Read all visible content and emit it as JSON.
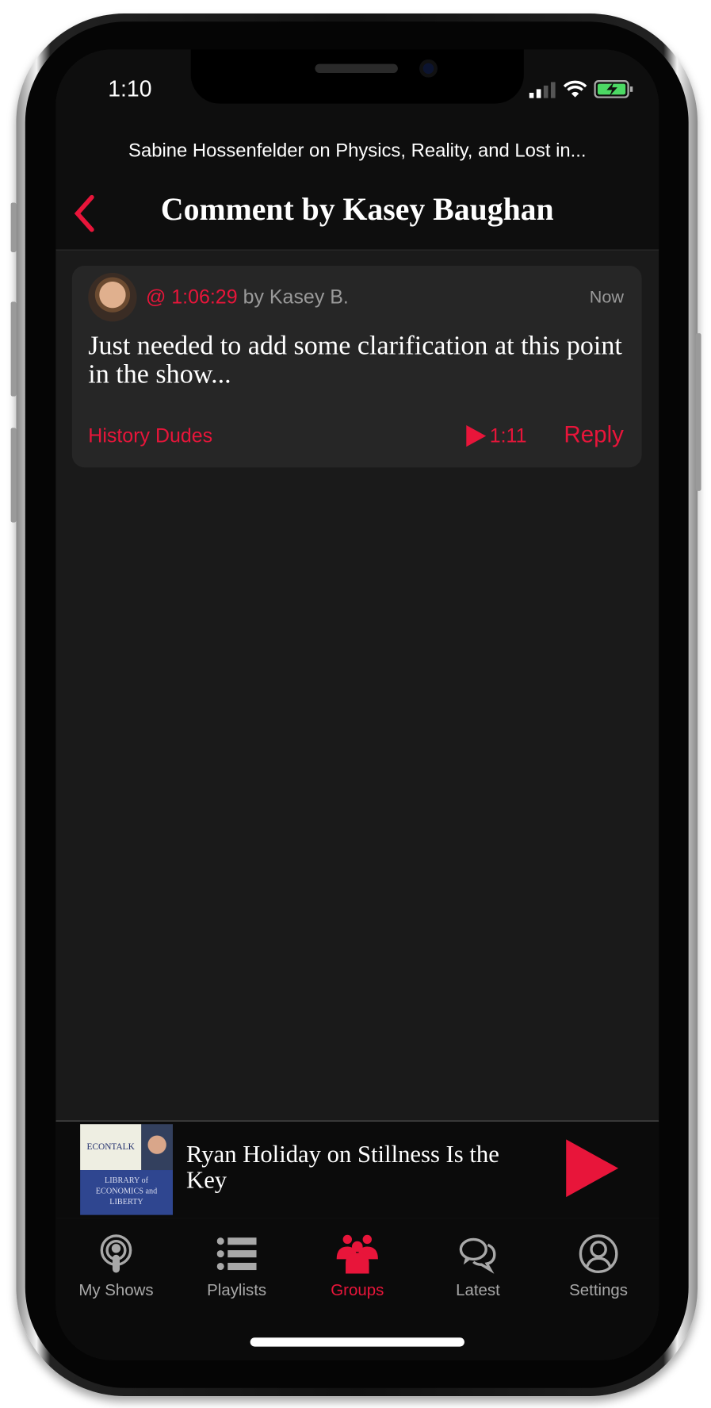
{
  "status_bar": {
    "time": "1:10"
  },
  "header": {
    "episode_title": "Sabine Hossenfelder on Physics, Reality, and Lost in...",
    "title": "Comment by Kasey Baughan",
    "back_icon": "chevron-left-icon"
  },
  "comment": {
    "timestamp": "@ 1:06:29",
    "author": "by Kasey B.",
    "posted": "Now",
    "body": "Just needed to add some clarification at this point in the show...",
    "group": "History Dudes",
    "clip_duration": "1:11",
    "reply_label": "Reply"
  },
  "now_playing": {
    "title": "Ryan Holiday on Stillness Is the Key",
    "artwork_text": {
      "top": "ECONTALK",
      "bottom": "LIBRARY of ECONOMICS and LIBERTY"
    }
  },
  "tabs": [
    {
      "label": "My Shows",
      "icon": "podcast-icon",
      "active": false
    },
    {
      "label": "Playlists",
      "icon": "list-icon",
      "active": false
    },
    {
      "label": "Groups",
      "icon": "group-icon",
      "active": true
    },
    {
      "label": "Latest",
      "icon": "chat-bubbles-icon",
      "active": false
    },
    {
      "label": "Settings",
      "icon": "person-icon",
      "active": false
    }
  ],
  "colors": {
    "accent": "#e8153a",
    "background": "#1a1a1a",
    "card": "#262626"
  }
}
